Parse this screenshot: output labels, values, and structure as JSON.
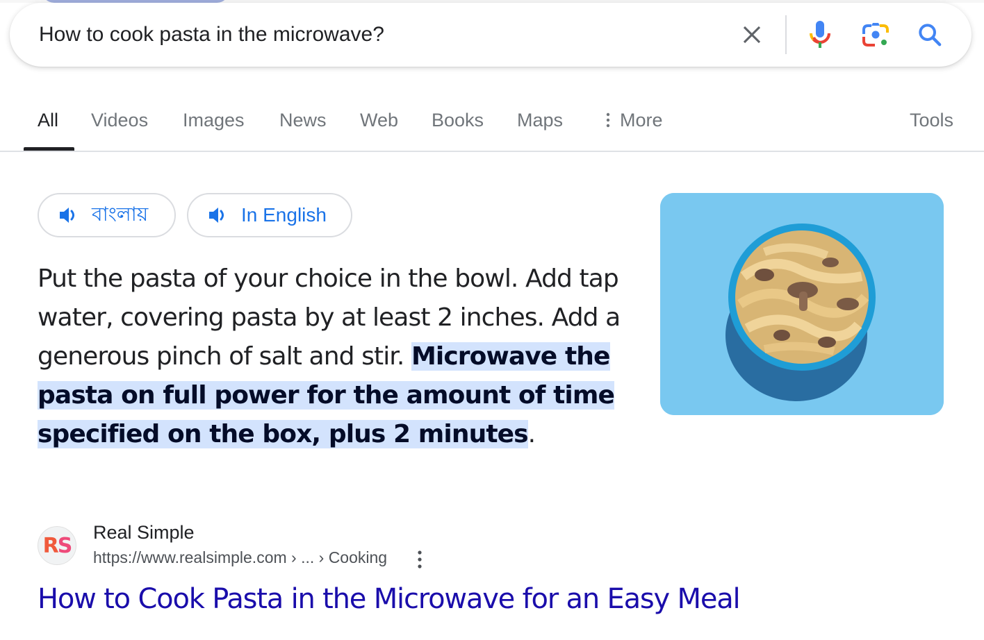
{
  "search": {
    "query": "How to cook pasta in the microwave?",
    "clear_icon": "close-icon",
    "voice_icon": "microphone-icon",
    "lens_icon": "google-lens-icon",
    "search_icon": "search-icon"
  },
  "tabs": {
    "items": [
      {
        "label": "All",
        "active": true
      },
      {
        "label": "Videos"
      },
      {
        "label": "Images"
      },
      {
        "label": "News"
      },
      {
        "label": "Web"
      },
      {
        "label": "Books"
      },
      {
        "label": "Maps"
      },
      {
        "label": "More"
      }
    ],
    "tools_label": "Tools"
  },
  "audio_chips": [
    {
      "label": "বাংলায়",
      "icon": "speaker-icon"
    },
    {
      "label": "In English",
      "icon": "speaker-icon"
    }
  ],
  "snippet": {
    "text_plain": "Put the pasta of your choice in the bowl. Add tap water, covering pasta by at least 2 inches. Add a generous pinch of salt and stir.",
    "text_highlighted": "Microwave the pasta on full power for the amount of time specified on the box, plus 2 minutes",
    "text_tail": ".",
    "image_alt": "Bowl of tagliatelle pasta with mushrooms on a blue background"
  },
  "source": {
    "favicon_text": "RS",
    "name": "Real Simple",
    "url": "https://www.realsimple.com › ... › Cooking",
    "menu_icon": "more-vert-icon"
  },
  "result": {
    "title": "How to Cook Pasta in the Microwave for an Easy Meal"
  },
  "colors": {
    "link": "#1a0dab",
    "accent_blue": "#1a73e8",
    "highlight": "#d3e3fd",
    "image_bg": "#79c8f0"
  }
}
